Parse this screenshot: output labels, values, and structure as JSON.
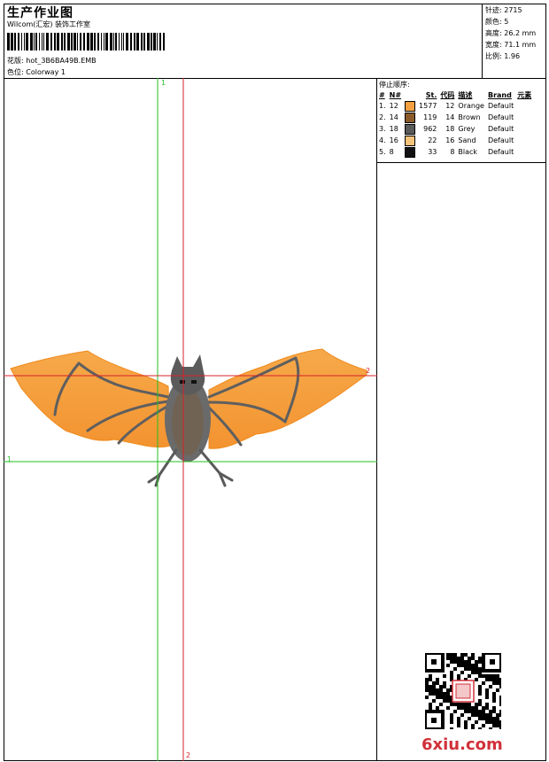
{
  "header": {
    "title": "生产作业图",
    "subtitle": "Wilcom(汇宏) 装饰工作室",
    "design_label": "花版:",
    "design_value": "hot_3B6BA49B.EMB",
    "colorway_label": "色位:",
    "colorway_value": "Colorway 1"
  },
  "stats": [
    {
      "label": "针迹:",
      "value": "2715"
    },
    {
      "label": "颜色:",
      "value": "5"
    },
    {
      "label": "高度:",
      "value": "26.2 mm"
    },
    {
      "label": "宽度:",
      "value": "71.1 mm"
    },
    {
      "label": "比例:",
      "value": "1.96"
    }
  ],
  "stop_sequence": {
    "title": "停止顺序:",
    "columns": [
      "#",
      "N#",
      "St.",
      "代码",
      "描述",
      "Brand",
      "元素"
    ],
    "rows": [
      {
        "n": "1.",
        "needle": "12",
        "color": "#f2a040",
        "stitches": "1577",
        "code": "12",
        "desc": "Orange",
        "brand": "Default"
      },
      {
        "n": "2.",
        "needle": "14",
        "color": "#8b5a2b",
        "stitches": "119",
        "code": "14",
        "desc": "Brown",
        "brand": "Default"
      },
      {
        "n": "3.",
        "needle": "18",
        "color": "#5a5a5a",
        "stitches": "962",
        "code": "18",
        "desc": "Grey",
        "brand": "Default"
      },
      {
        "n": "4.",
        "needle": "16",
        "color": "#f5c27a",
        "stitches": "22",
        "code": "16",
        "desc": "Sand",
        "brand": "Default"
      },
      {
        "n": "5.",
        "needle": "8",
        "color": "#111111",
        "stitches": "33",
        "code": "8",
        "desc": "Black",
        "brand": "Default"
      }
    ]
  },
  "axes": {
    "green": "1",
    "red": "2"
  },
  "watermark": "6xiu.com",
  "colors": {
    "green_guide": "#22c022",
    "red_guide": "#d8202a",
    "watermark": "#d1313a"
  }
}
